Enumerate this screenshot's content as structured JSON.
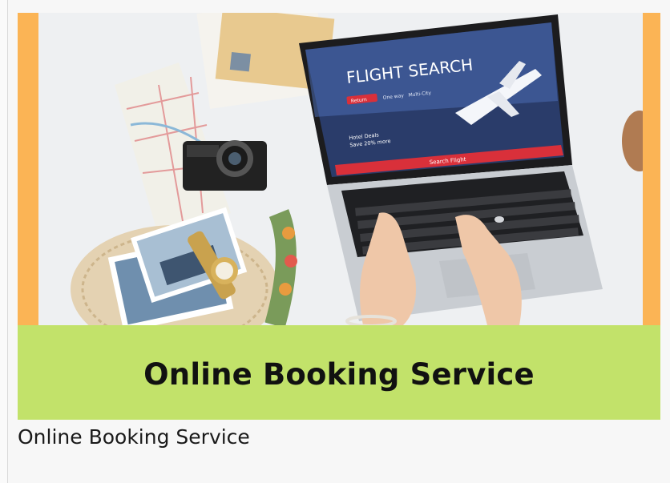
{
  "figure": {
    "screen_title": "FLIGHT SEARCH",
    "screen_tabs": [
      "Return",
      "One way",
      "Multi-City"
    ],
    "screen_deal_line1": "Hotel Deals",
    "screen_deal_line2": "Save 20% more",
    "screen_button": "Search Flight",
    "banner_text": "Online Booking Service",
    "colors": {
      "stripe": "#fbb455",
      "banner": "#c2e26a",
      "screen_red": "#d9303a"
    }
  },
  "caption": "Online Booking Service"
}
